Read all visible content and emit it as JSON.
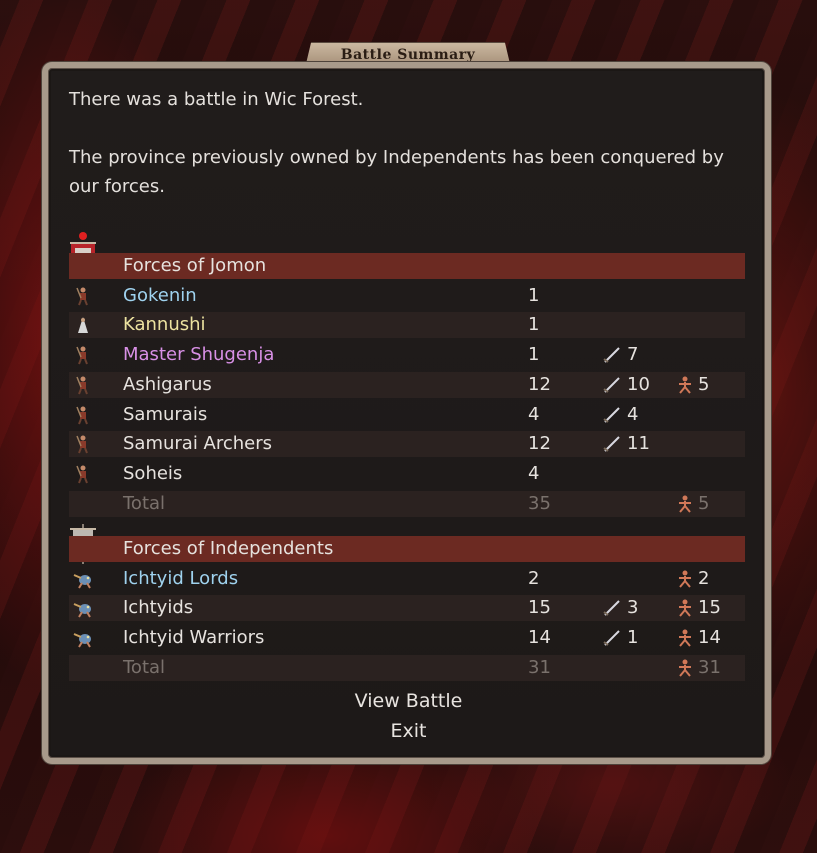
{
  "dialog": {
    "title": "Battle Summary"
  },
  "intro": {
    "line1": "There was a battle in Wic Forest.",
    "line2": "The province previously owned by Independents has been conquered by our forces."
  },
  "colors": {
    "header_row": "#6c2a22",
    "commander_blue": "#9fd2ee",
    "priest_yellow": "#ece2a0",
    "mage_purple": "#d890e6"
  },
  "jomon": {
    "header": "Forces of Jomon",
    "units": [
      {
        "name": "Gokenin",
        "count": "1",
        "kills": "",
        "lost": "",
        "color": "blue",
        "icon": "warrior-icon"
      },
      {
        "name": "Kannushi",
        "count": "1",
        "kills": "",
        "lost": "",
        "color": "yellow",
        "icon": "priest-icon"
      },
      {
        "name": "Master Shugenja",
        "count": "1",
        "kills": "7",
        "lost": "",
        "color": "purple",
        "icon": "mage-icon"
      },
      {
        "name": "Ashigarus",
        "count": "12",
        "kills": "10",
        "lost": "5",
        "color": "white",
        "icon": "spearman-icon"
      },
      {
        "name": "Samurais",
        "count": "4",
        "kills": "4",
        "lost": "",
        "color": "white",
        "icon": "samurai-icon"
      },
      {
        "name": "Samurai Archers",
        "count": "12",
        "kills": "11",
        "lost": "",
        "color": "white",
        "icon": "archer-icon"
      },
      {
        "name": "Soheis",
        "count": "4",
        "kills": "",
        "lost": "",
        "color": "white",
        "icon": "monk-icon"
      }
    ],
    "total": {
      "label": "Total",
      "count": "35",
      "lost": "5"
    }
  },
  "independents": {
    "header": "Forces of Independents",
    "units": [
      {
        "name": "Ichtyid Lords",
        "count": "2",
        "kills": "",
        "lost": "2",
        "color": "blue",
        "icon": "fishman-icon"
      },
      {
        "name": "Ichtyids",
        "count": "15",
        "kills": "3",
        "lost": "15",
        "color": "white",
        "icon": "fishman-icon"
      },
      {
        "name": "Ichtyid Warriors",
        "count": "14",
        "kills": "1",
        "lost": "14",
        "color": "white",
        "icon": "fishman-icon"
      }
    ],
    "total": {
      "label": "Total",
      "count": "31",
      "lost": "31"
    }
  },
  "actions": {
    "view_battle": "View Battle",
    "exit": "Exit"
  }
}
